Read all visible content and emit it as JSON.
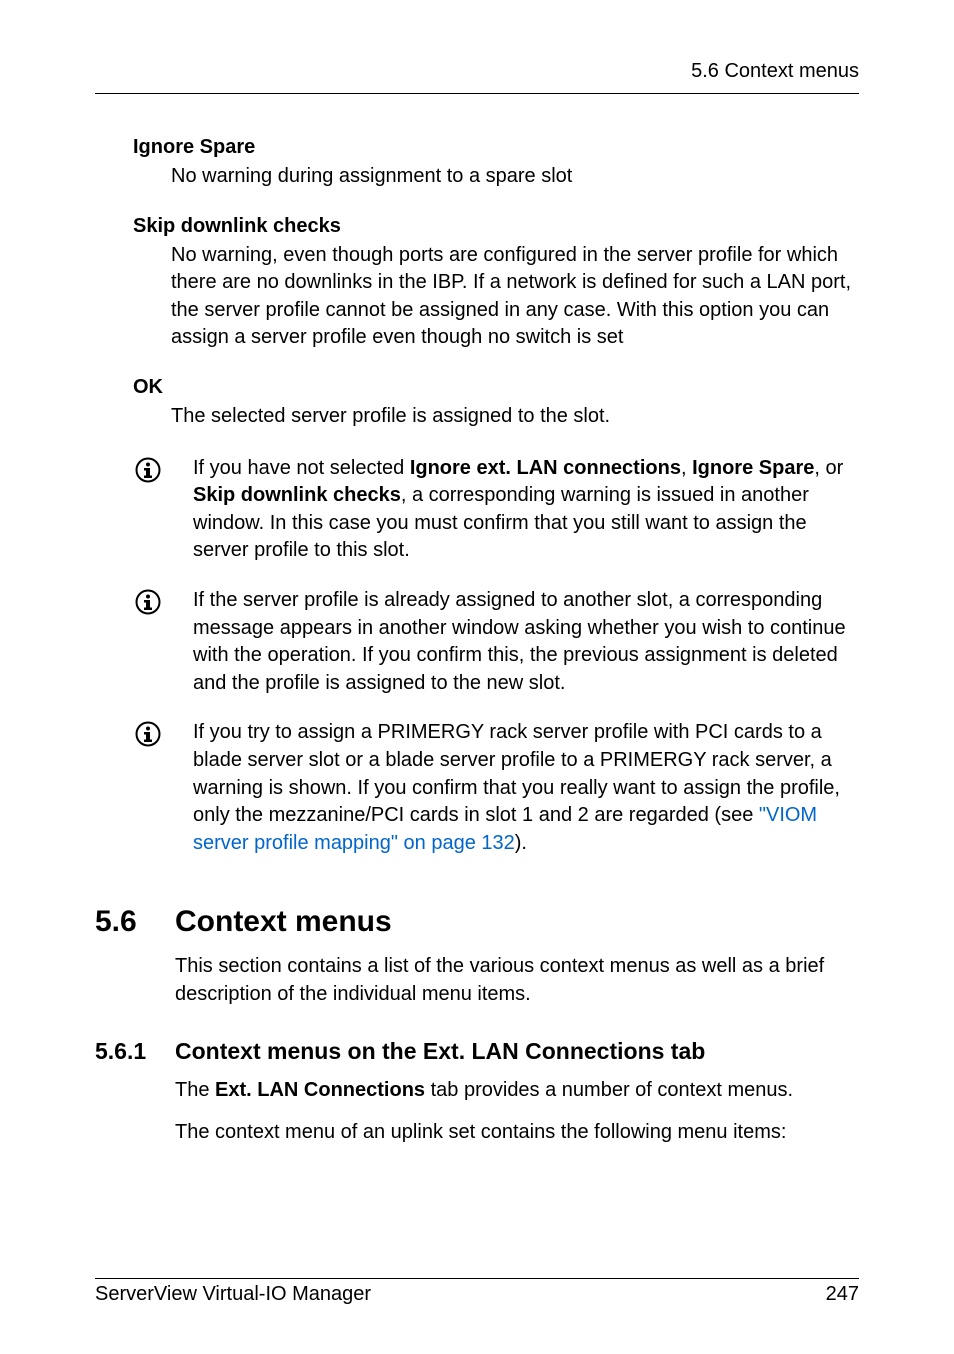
{
  "header": {
    "breadcrumb": "5.6 Context menus"
  },
  "definitions": [
    {
      "term": "Ignore Spare",
      "def": "No warning during assignment to a spare slot"
    },
    {
      "term": "Skip downlink checks",
      "def": "No warning, even though ports are configured in the server profile for which there are no downlinks in the IBP. If a network is defined for such a LAN port, the server profile cannot be assigned in any case. With this option you can assign a server profile even though no switch is set"
    },
    {
      "term": "OK",
      "def": "The selected server profile is assigned to the slot."
    }
  ],
  "info_notes": [
    {
      "prefix": "If you have not selected ",
      "bold1": "Ignore ext. LAN connections",
      "mid1": ", ",
      "bold2": "Ignore Spare",
      "mid2": ", or ",
      "bold3": "Skip downlink checks",
      "suffix": ", a corresponding warning is issued in another window. In this case you must confirm that you still want to assign the server profile to this slot."
    },
    {
      "text": "If the server profile is already assigned to another slot, a corresponding message appears in another window asking whether you wish to continue with the operation. If you confirm this, the previous assignment is deleted and the profile is assigned to the new slot."
    },
    {
      "prefix": "If you try to assign a PRIMERGY rack server profile with PCI cards to a blade server slot or a blade server profile to a PRIMERGY rack server, a warning is shown. If you confirm that you really want to assign the profile, only the mezzanine/PCI cards in slot 1 and 2 are regarded (see ",
      "link": "\"VIOM server profile mapping\" on page 132",
      "suffix": ")."
    }
  ],
  "section": {
    "number": "5.6",
    "title": "Context menus",
    "body": "This section contains a list of the various context menus as well as a brief description of the individual menu items."
  },
  "subsection": {
    "number": "5.6.1",
    "title": "Context menus on the Ext. LAN Connections tab",
    "body_prefix": "The ",
    "body_bold": "Ext. LAN Connections",
    "body_suffix": " tab provides a number of context menus.",
    "body2": "The context menu of an uplink set contains the following menu items:"
  },
  "footer": {
    "left": "ServerView Virtual-IO Manager",
    "right": "247"
  }
}
